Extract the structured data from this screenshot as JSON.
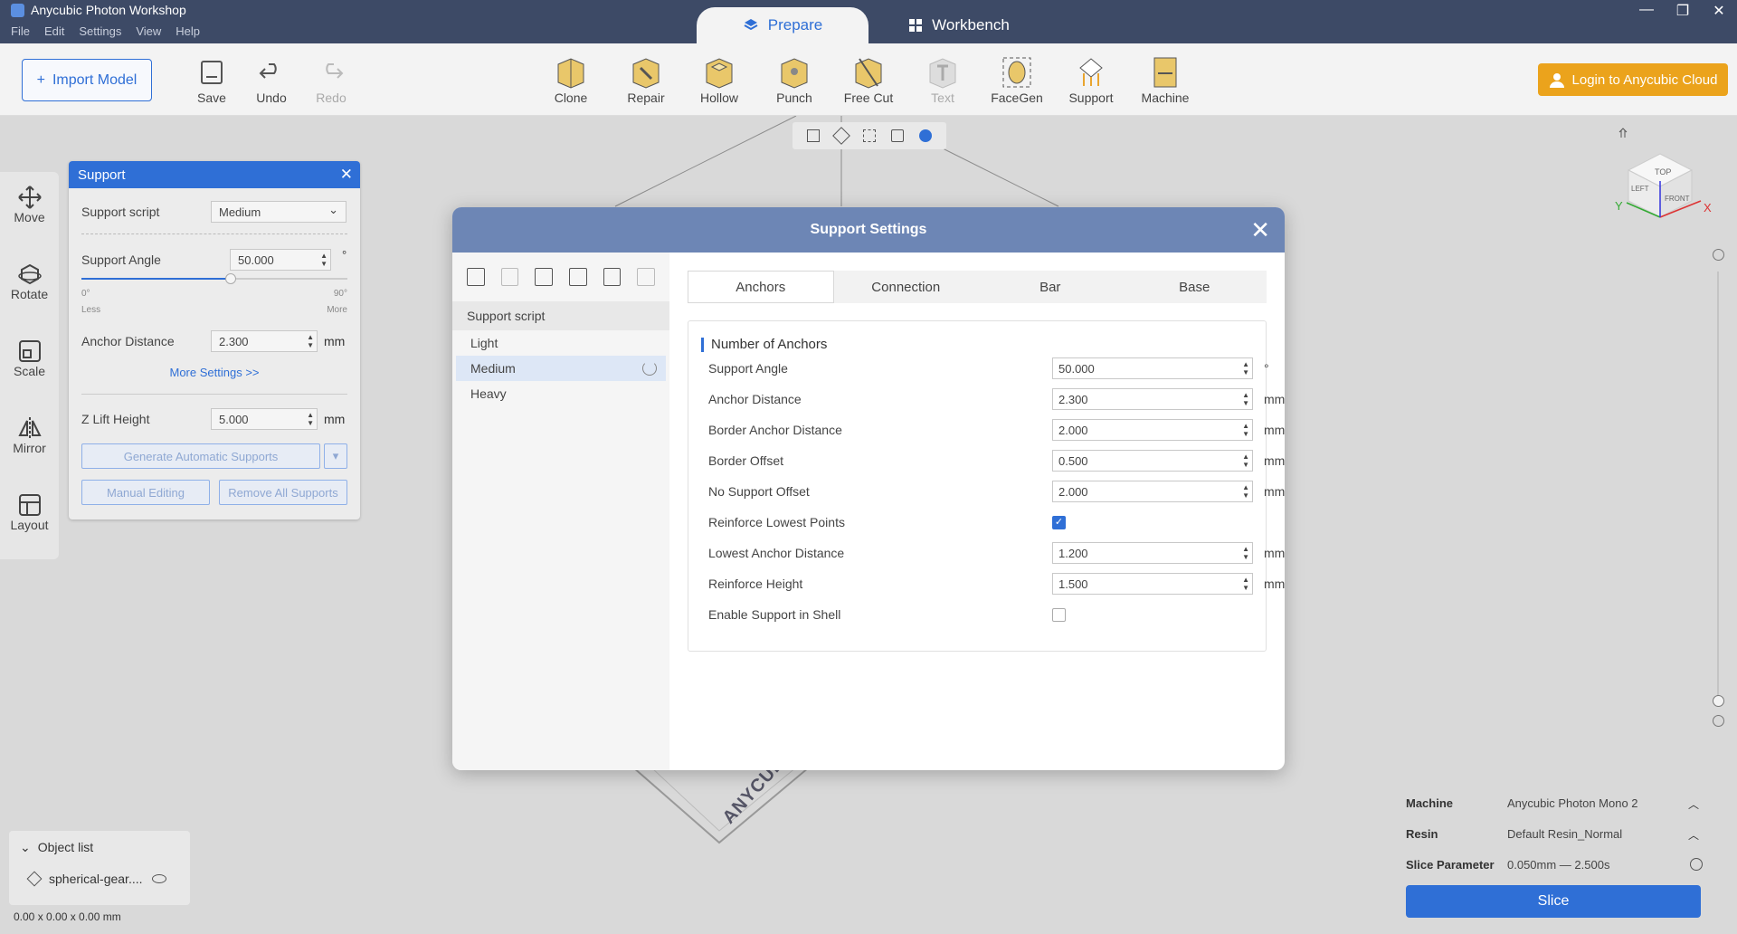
{
  "app": {
    "title": "Anycubic Photon Workshop"
  },
  "menu": [
    "File",
    "Edit",
    "Settings",
    "View",
    "Help"
  ],
  "mode_tabs": {
    "prepare": "Prepare",
    "workbench": "Workbench"
  },
  "toolbar": {
    "import": "Import Model",
    "save": "Save",
    "undo": "Undo",
    "redo": "Redo",
    "clone": "Clone",
    "repair": "Repair",
    "hollow": "Hollow",
    "punch": "Punch",
    "free_cut": "Free Cut",
    "text": "Text",
    "facegen": "FaceGen",
    "support": "Support",
    "machine": "Machine",
    "login": "Login to Anycubic Cloud"
  },
  "rail": {
    "move": "Move",
    "rotate": "Rotate",
    "scale": "Scale",
    "mirror": "Mirror",
    "layout": "Layout"
  },
  "support_panel": {
    "title": "Support",
    "script_label": "Support script",
    "script_value": "Medium",
    "angle_label": "Support Angle",
    "angle_value": "50.000",
    "angle_unit": "°",
    "slider_min": "0°",
    "slider_max": "90°",
    "slider_less": "Less",
    "slider_more": "More",
    "slider_fraction": 0.56,
    "anchor_label": "Anchor Distance",
    "anchor_value": "2.300",
    "anchor_unit": "mm",
    "more_settings": "More Settings >>",
    "zlift_label": "Z Lift Height",
    "zlift_value": "5.000",
    "zlift_unit": "mm",
    "generate": "Generate Automatic Supports",
    "manual": "Manual Editing",
    "remove": "Remove All Supports"
  },
  "dialog": {
    "title": "Support Settings",
    "script_head": "Support script",
    "scripts": [
      "Light",
      "Medium",
      "Heavy"
    ],
    "tabs": [
      "Anchors",
      "Connection",
      "Bar",
      "Base"
    ],
    "section": "Number of Anchors",
    "rows": [
      {
        "label": "Support Angle",
        "value": "50.000",
        "unit": "°"
      },
      {
        "label": "Anchor Distance",
        "value": "2.300",
        "unit": "mm"
      },
      {
        "label": "Border Anchor Distance",
        "value": "2.000",
        "unit": "mm"
      },
      {
        "label": "Border Offset",
        "value": "0.500",
        "unit": "mm"
      },
      {
        "label": "No Support Offset",
        "value": "2.000",
        "unit": "mm"
      },
      {
        "label": "Reinforce Lowest Points",
        "checked": true
      },
      {
        "label": "Lowest Anchor Distance",
        "value": "1.200",
        "unit": "mm"
      },
      {
        "label": "Reinforce Height",
        "value": "1.500",
        "unit": "mm"
      },
      {
        "label": "Enable Support in Shell",
        "checked": false
      }
    ]
  },
  "cube": {
    "top": "TOP",
    "left": "LEFT",
    "front": "FRONT",
    "x": "X",
    "y": "Y"
  },
  "bottom": {
    "machine_label": "Machine",
    "machine_value": "Anycubic Photon Mono 2",
    "resin_label": "Resin",
    "resin_value": "Default Resin_Normal",
    "slice_label": "Slice Parameter",
    "slice_value": "0.050mm — 2.500s",
    "slice_btn": "Slice"
  },
  "object_list": {
    "title": "Object list",
    "item": "spherical-gear....",
    "dims": "0.00 x 0.00 x 0.00 mm"
  },
  "plate_logo": "ANYCUB"
}
